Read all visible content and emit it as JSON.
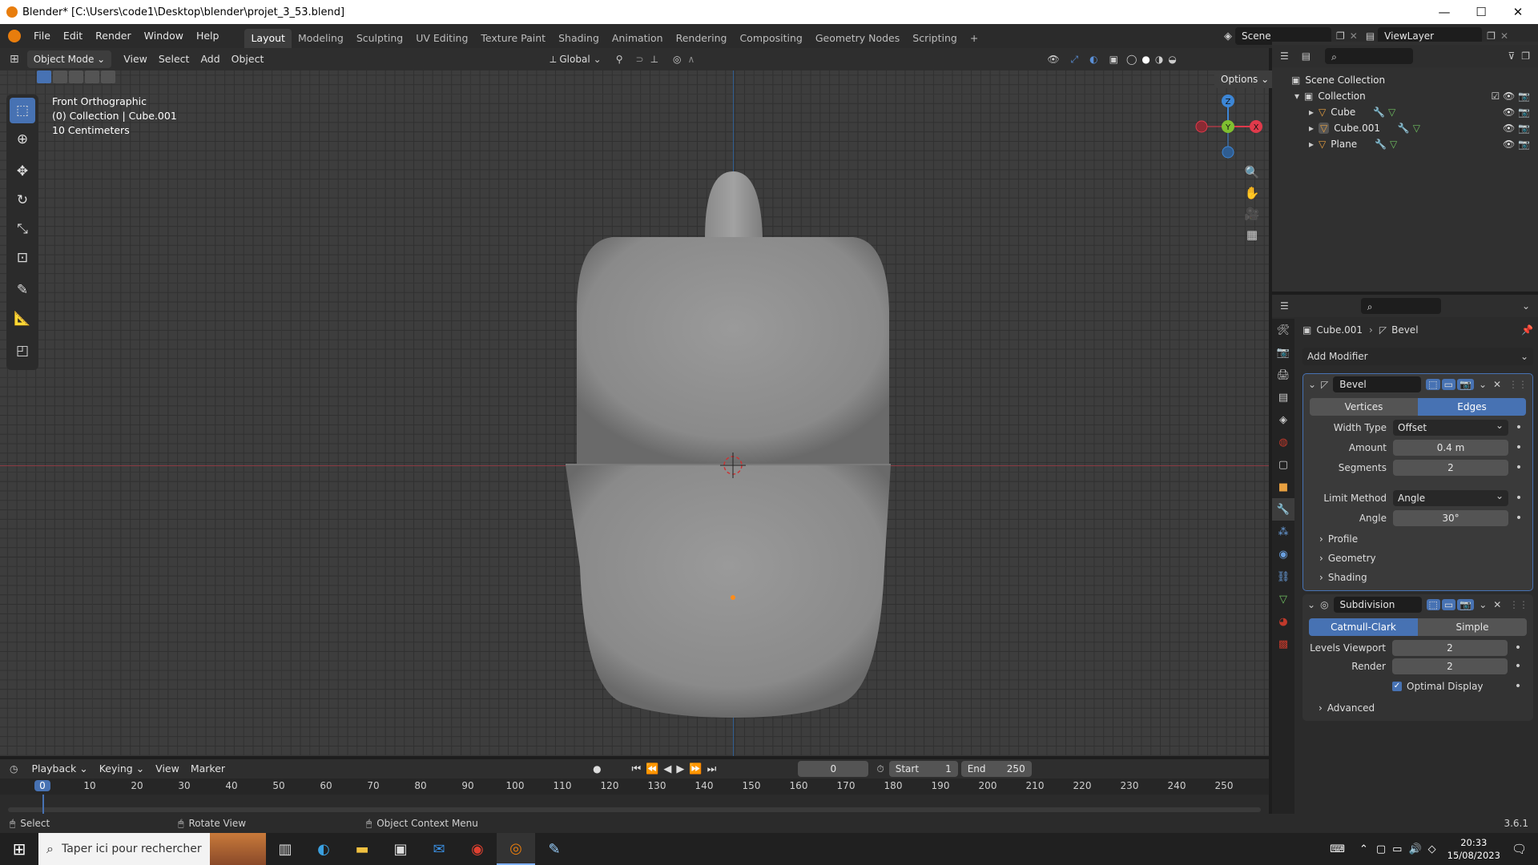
{
  "window": {
    "title": "Blender* [C:\\Users\\code1\\Desktop\\blender\\projet_3_53.blend]",
    "minimize": "—",
    "maximize": "☐",
    "close": "✕"
  },
  "menu": {
    "file": "File",
    "edit": "Edit",
    "render": "Render",
    "window": "Window",
    "help": "Help"
  },
  "workspaces": [
    "Layout",
    "Modeling",
    "Sculpting",
    "UV Editing",
    "Texture Paint",
    "Shading",
    "Animation",
    "Rendering",
    "Compositing",
    "Geometry Nodes",
    "Scripting",
    "+"
  ],
  "scene": {
    "name": "Scene",
    "viewlayer": "ViewLayer"
  },
  "header": {
    "mode": "Object Mode",
    "view": "View",
    "select": "Select",
    "add": "Add",
    "object": "Object",
    "orientation": "Global",
    "options": "Options"
  },
  "viewport": {
    "view_name": "Front Orthographic",
    "collection_info": "(0) Collection | Cube.001",
    "scale": "10 Centimeters"
  },
  "gizmo": {
    "z": "Z",
    "y": "Y",
    "x": "X"
  },
  "outliner": {
    "root": "Scene Collection",
    "collection": "Collection",
    "items": [
      {
        "name": "Cube"
      },
      {
        "name": "Cube.001"
      },
      {
        "name": "Plane"
      }
    ]
  },
  "properties": {
    "breadcrumb_object": "Cube.001",
    "breadcrumb_modifier": "Bevel",
    "add_modifier": "Add Modifier",
    "bevel": {
      "name": "Bevel",
      "tab_vertices": "Vertices",
      "tab_edges": "Edges",
      "width_type_label": "Width Type",
      "width_type": "Offset",
      "amount_label": "Amount",
      "amount": "0.4 m",
      "segments_label": "Segments",
      "segments": "2",
      "limit_label": "Limit Method",
      "limit": "Angle",
      "angle_label": "Angle",
      "angle": "30°",
      "profile": "Profile",
      "geometry": "Geometry",
      "shading": "Shading"
    },
    "subdivision": {
      "name": "Subdivision",
      "tab_cc": "Catmull-Clark",
      "tab_simple": "Simple",
      "levels_label": "Levels Viewport",
      "levels": "2",
      "render_label": "Render",
      "render": "2",
      "optimal": "Optimal Display",
      "advanced": "Advanced"
    }
  },
  "timeline": {
    "playback": "Playback",
    "keying": "Keying",
    "view": "View",
    "marker": "Marker",
    "current": "0",
    "start_label": "Start",
    "start": "1",
    "end_label": "End",
    "end": "250",
    "ticks": [
      "0",
      "10",
      "20",
      "30",
      "40",
      "50",
      "60",
      "70",
      "80",
      "90",
      "100",
      "110",
      "120",
      "130",
      "140",
      "150",
      "160",
      "170",
      "180",
      "190",
      "200",
      "210",
      "220",
      "230",
      "240",
      "250"
    ]
  },
  "status": {
    "select": "Select",
    "rotate": "Rotate View",
    "context": "Object Context Menu",
    "version": "3.6.1"
  },
  "taskbar": {
    "search": "Taper ici pour rechercher",
    "time": "20:33",
    "date": "15/08/2023"
  },
  "colors": {
    "accent": "#4772b3",
    "x_axis": "#e03a4b",
    "y_axis": "#7fbf30",
    "z_axis": "#3c86d6",
    "blender_orange": "#e87d0d"
  }
}
